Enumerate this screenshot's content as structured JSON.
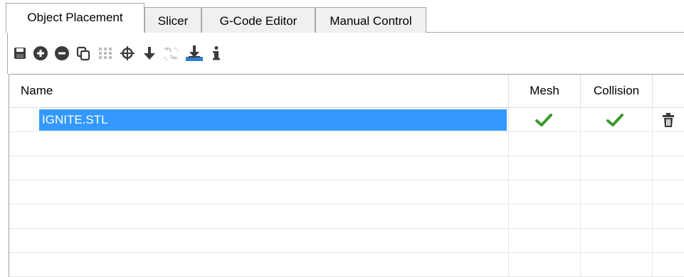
{
  "tabs": [
    {
      "label": "Object Placement",
      "active": true
    },
    {
      "label": "Slicer",
      "active": false
    },
    {
      "label": "G-Code Editor",
      "active": false
    },
    {
      "label": "Manual Control",
      "active": false
    }
  ],
  "toolbar": {
    "icons": [
      "save-icon",
      "add-icon",
      "remove-icon",
      "copy-icon",
      "grid-icon",
      "center-icon",
      "drop-icon",
      "cut-icon",
      "land-icon",
      "info-icon"
    ]
  },
  "grid": {
    "columns": {
      "name": "Name",
      "mesh": "Mesh",
      "collision": "Collision"
    },
    "rows": [
      {
        "name": "IGNITE.STL",
        "mesh_ok": true,
        "collision_ok": true,
        "selected": true
      }
    ]
  },
  "colors": {
    "selection": "#3399ff",
    "check": "#3a9a2c",
    "accent": "#2f7fd1"
  }
}
